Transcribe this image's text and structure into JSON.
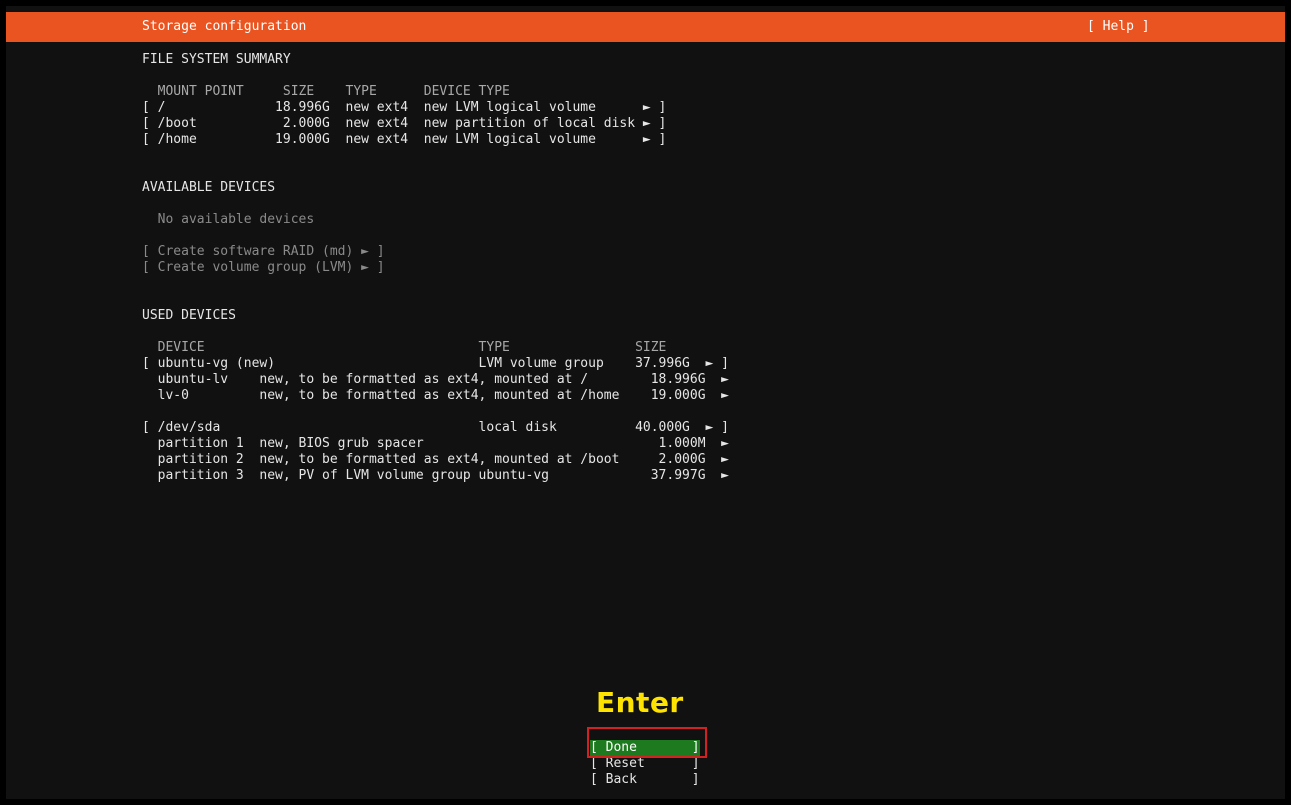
{
  "header": {
    "title": "Storage configuration",
    "help": "[ Help ]"
  },
  "fs_summary": {
    "heading": "FILE SYSTEM SUMMARY",
    "columns_line": "  MOUNT POINT     SIZE    TYPE      DEVICE TYPE",
    "rows": [
      "[ /              18.996G  new ext4  new LVM logical volume      ► ]",
      "[ /boot           2.000G  new ext4  new partition of local disk ► ]",
      "[ /home          19.000G  new ext4  new LVM logical volume      ► ]"
    ]
  },
  "available": {
    "heading": "AVAILABLE DEVICES",
    "empty": "  No available devices",
    "raid": "[ Create software RAID (md) ► ]",
    "lvm": "[ Create volume group (LVM) ► ]"
  },
  "used": {
    "heading": "USED DEVICES",
    "columns_line": "  DEVICE                                   TYPE                SIZE",
    "groups": [
      {
        "main": "[ ubuntu-vg (new)                          LVM volume group    37.996G  ► ]",
        "children": [
          "  ubuntu-lv    new, to be formatted as ext4, mounted at /        18.996G  ►",
          "  lv-0         new, to be formatted as ext4, mounted at /home    19.000G  ►"
        ]
      },
      {
        "main": "[ /dev/sda                                 local disk          40.000G  ► ]",
        "children": [
          "  partition 1  new, BIOS grub spacer                              1.000M  ►",
          "  partition 2  new, to be formatted as ext4, mounted at /boot     2.000G  ►",
          "  partition 3  new, PV of LVM volume group ubuntu-vg             37.997G  ►"
        ]
      }
    ]
  },
  "buttons": {
    "done": "[ Done       ]",
    "reset": "[ Reset      ]",
    "back": "[ Back       ]"
  },
  "annotation": {
    "label": "Enter"
  },
  "colors": {
    "header_bg": "#e95420",
    "done_bg": "#1e7a1e",
    "annotation": "#ffe300",
    "annotation_box": "#d32020"
  }
}
